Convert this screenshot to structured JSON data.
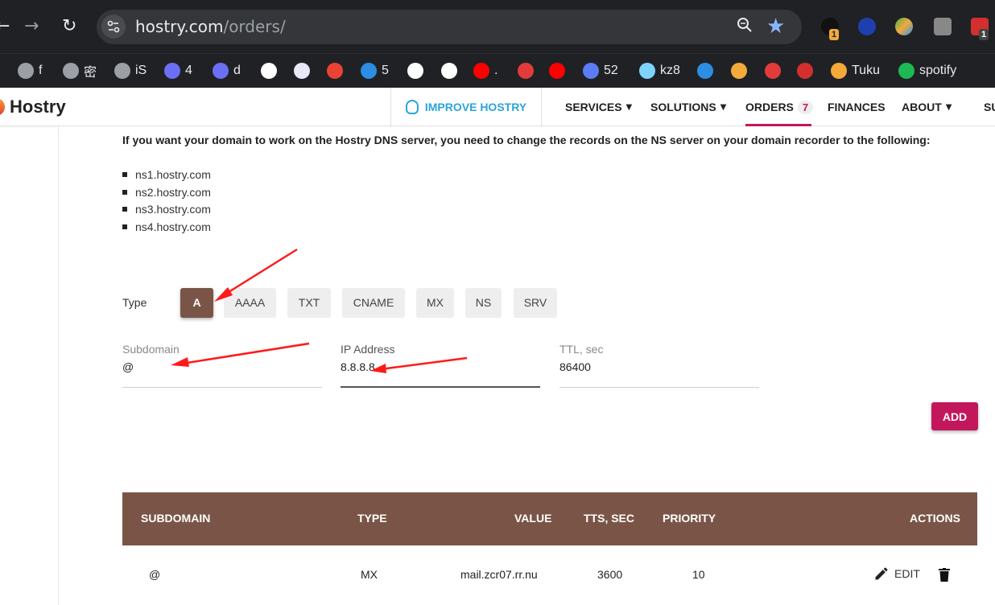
{
  "browser": {
    "nav": {
      "back": "←",
      "forward": "→",
      "reload": "↻"
    },
    "url_domain": "hostry.com",
    "url_path": "/orders/",
    "ext_badges": {
      "first": "1",
      "last": "1"
    },
    "bookmarks": [
      {
        "label": "f",
        "icon": "globe-icon",
        "color": "#9aa0a6"
      },
      {
        "label": "密",
        "icon": "globe-icon",
        "color": "#9aa0a6"
      },
      {
        "label": "iS",
        "icon": "globe-icon",
        "color": "#9aa0a6"
      },
      {
        "label": "4",
        "icon": "ghost-icon",
        "color": "#6b6ff5"
      },
      {
        "label": "d",
        "icon": "ghost-icon",
        "color": "#6b6ff5"
      },
      {
        "label": "",
        "icon": "openai-icon",
        "color": "#ffffff"
      },
      {
        "label": "",
        "icon": "face-icon",
        "color": "#e8e8f8"
      },
      {
        "label": "",
        "icon": "gmail-icon",
        "color": "#ea4335"
      },
      {
        "label": "5",
        "icon": "cloud-icon",
        "color": "#2b8de3"
      },
      {
        "label": "",
        "icon": "github-icon",
        "color": "#ffffff"
      },
      {
        "label": "",
        "icon": "google-icon",
        "color": "#ffffff"
      },
      {
        "label": ".",
        "icon": "youtube-icon",
        "color": "#ff0000"
      },
      {
        "label": "",
        "icon": "red-glyph-icon",
        "color": "#e23b3b"
      },
      {
        "label": "",
        "icon": "youtube-icon",
        "color": "#ff0000"
      },
      {
        "label": "52",
        "icon": "ring-icon",
        "color": "#5b7cf5"
      },
      {
        "label": "kz8",
        "icon": "mountain-icon",
        "color": "#7dd3fc"
      },
      {
        "label": "",
        "icon": "flower-icon",
        "color": "#2b8de3"
      },
      {
        "label": "",
        "icon": "orange-icon",
        "color": "#f4a93b"
      },
      {
        "label": "",
        "icon": "red-square-icon",
        "color": "#e23b3b"
      },
      {
        "label": "",
        "icon": "seal-icon",
        "color": "#d32f2f"
      },
      {
        "label": "Tuku",
        "icon": "pinwheel-icon",
        "color": "#f4a93b"
      },
      {
        "label": "spotify",
        "icon": "spotify-icon",
        "color": "#1db954"
      }
    ]
  },
  "site": {
    "logo": "Hostry",
    "improve": "IMPROVE HOSTRY",
    "menu": {
      "services": "SERVICES",
      "solutions": "SOLUTIONS",
      "orders": "ORDERS",
      "orders_count": "7",
      "finances": "FINANCES",
      "about": "ABOUT",
      "support_partial": "SU"
    },
    "accent": "#c2185b",
    "brown": "#7a5547",
    "info_color": "#2aa5d8"
  },
  "dns": {
    "note": "If you want your domain to work on the Hostry DNS server, you need to change the records on the NS server on your domain recorder to the following:",
    "ns": [
      "ns1.hostry.com",
      "ns2.hostry.com",
      "ns3.hostry.com",
      "ns4.hostry.com"
    ]
  },
  "form": {
    "type_label": "Type",
    "types": [
      "A",
      "AAAA",
      "TXT",
      "CNAME",
      "MX",
      "NS",
      "SRV"
    ],
    "selected_type": "A",
    "subdomain": {
      "label": "Subdomain",
      "value": "@"
    },
    "ip": {
      "label": "IP Address",
      "value": "8.8.8.8"
    },
    "ttl": {
      "label": "TTL, sec",
      "value": "86400"
    },
    "add": "ADD"
  },
  "table": {
    "headers": {
      "subdomain": "SUBDOMAIN",
      "type": "TYPE",
      "value": "VALUE",
      "tts": "TTS, SEC",
      "priority": "PRIORITY",
      "actions": "ACTIONS"
    },
    "rows": [
      {
        "subdomain": "@",
        "type": "MX",
        "value": "mail.zcr07.rr.nu",
        "tts": "3600",
        "priority": "10",
        "edit": "EDIT"
      }
    ]
  }
}
